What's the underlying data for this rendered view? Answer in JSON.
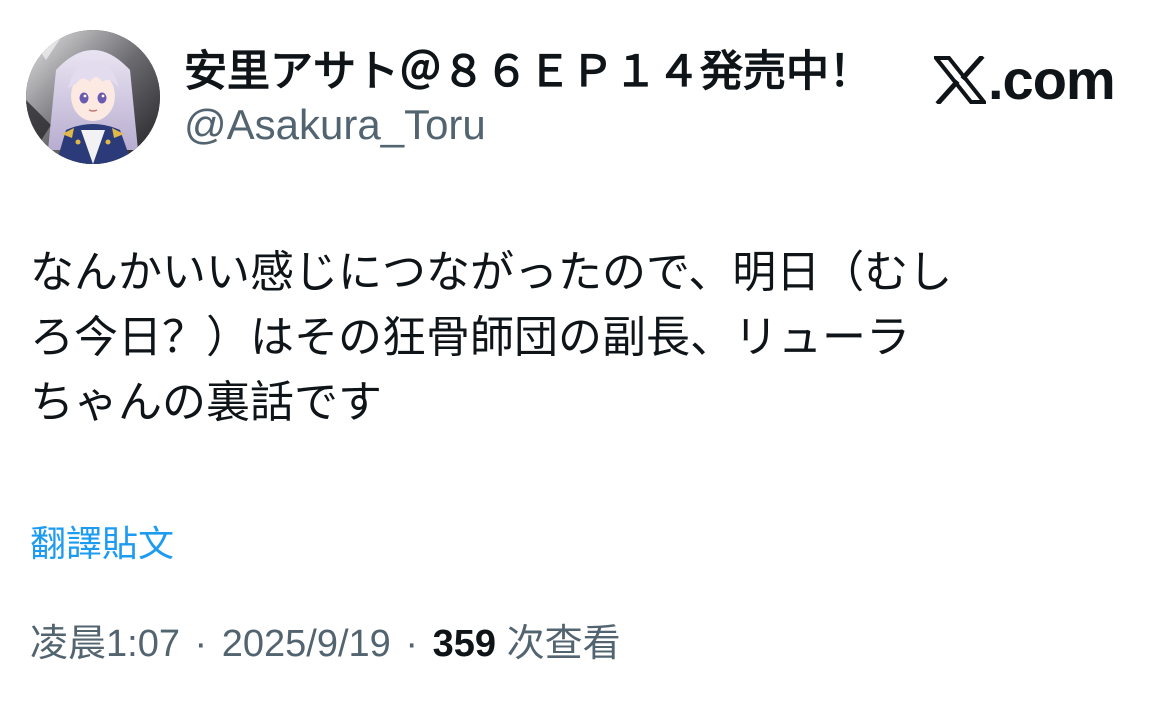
{
  "author": {
    "display_name": "安里アサト＠８６ＥＰ１４発売中！",
    "handle": "@Asakura_Toru",
    "avatar_icon": "avatar-anime-character-icon"
  },
  "brand": {
    "logo_icon": "x-logo-icon",
    "suffix": ".com"
  },
  "tweet": {
    "lines": [
      "なんかいい感じにつながったので、明日（むし",
      "ろ今日？）はその狂骨師団の副長、リューラ",
      "ちゃんの裏話です"
    ],
    "translate_label": "翻譯貼文"
  },
  "meta": {
    "time": "凌晨1:07",
    "separator": "·",
    "date": "2025/9/19",
    "views_count": "359",
    "views_label": "次查看"
  },
  "colors": {
    "link": "#1d9bf0",
    "secondary_text": "#536471",
    "primary_text": "#0f1419"
  }
}
